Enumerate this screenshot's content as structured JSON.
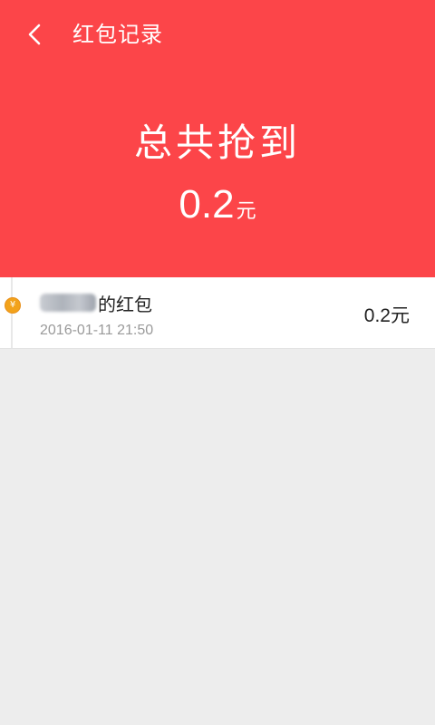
{
  "header": {
    "back_icon": "chevron-left-icon",
    "title": "红包记录",
    "background_color": "#fc4549"
  },
  "summary": {
    "label": "总共抢到",
    "amount": "0.2",
    "unit": "元"
  },
  "records": [
    {
      "sender_name": "[blurred]",
      "sender_suffix": "的红包",
      "time": "2016-01-11 21:50",
      "amount": "0.2",
      "unit": "元",
      "icon": "coin-icon",
      "icon_color": "#f2a21b"
    }
  ]
}
